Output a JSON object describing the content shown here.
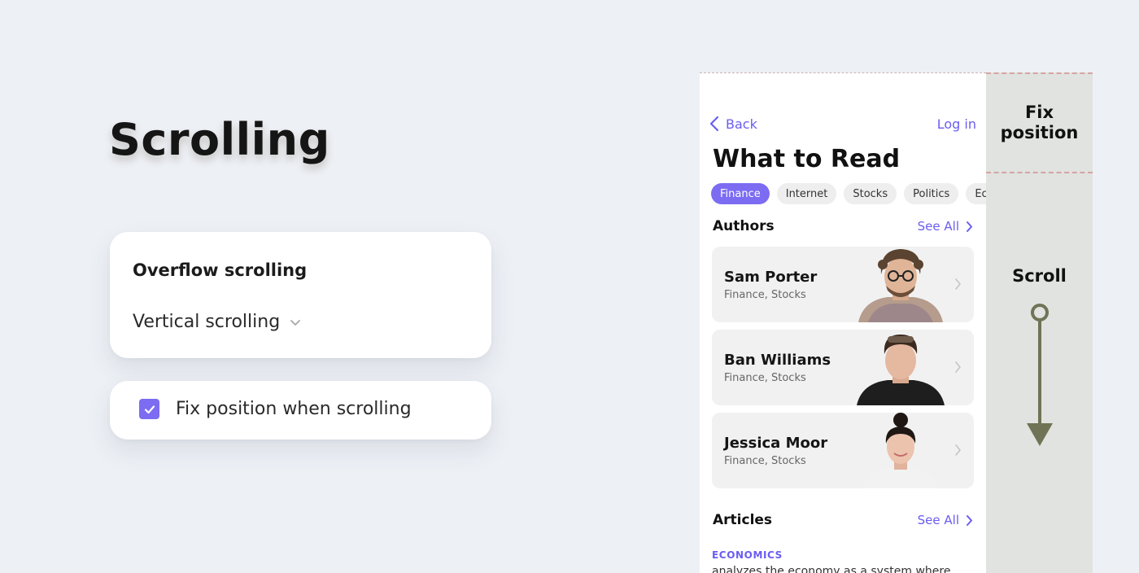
{
  "heading": "Scrolling",
  "overflow_panel": {
    "title": "Overflow scrolling",
    "select_value": "Vertical scrolling"
  },
  "fix_panel": {
    "checkbox_label": "Fix position when scrolling",
    "checked": true
  },
  "indicator": {
    "fix_label": "Fix position",
    "scroll_label": "Scroll"
  },
  "phone": {
    "back_label": "Back",
    "login_label": "Log in",
    "title": "What to Read",
    "chips": [
      "Finance",
      "Internet",
      "Stocks",
      "Politics",
      "Econ"
    ],
    "active_chip": "Finance",
    "authors_section": {
      "title": "Authors",
      "see_all": "See All"
    },
    "authors": [
      {
        "name": "Sam Porter",
        "tags": "Finance, Stocks"
      },
      {
        "name": "Ban Williams",
        "tags": "Finance, Stocks"
      },
      {
        "name": "Jessica Moor",
        "tags": "Finance, Stocks"
      }
    ],
    "articles_section": {
      "title": "Articles",
      "see_all": "See All"
    },
    "article": {
      "category": "ECONOMICS",
      "snippet": "analyzes the economy as a system where"
    }
  },
  "colors": {
    "accent": "#7c6cf2",
    "link": "#6a5df0",
    "background": "#edf0f5",
    "indicator_strip": "#e0e3df",
    "arrow": "#707355"
  }
}
